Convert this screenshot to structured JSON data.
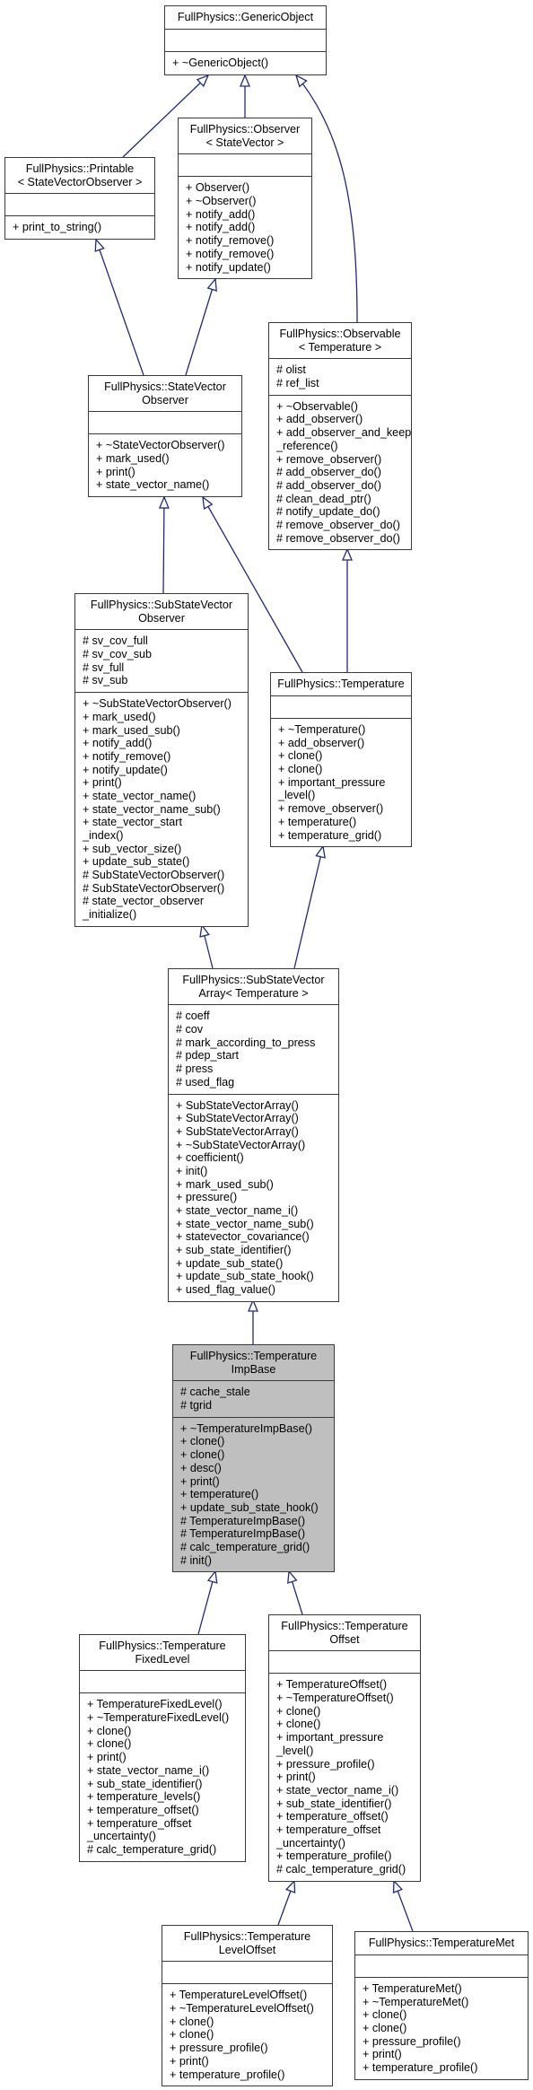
{
  "diagram": {
    "edge_color": "#1f2a7a",
    "highlight_fill": "#bfbfbf",
    "nodes": [
      {
        "id": "generic-object",
        "title": [
          "FullPhysics::GenericObject"
        ],
        "attributes": [],
        "methods": [
          "+ ~GenericObject()"
        ]
      },
      {
        "id": "printable",
        "title": [
          "FullPhysics::Printable",
          "< StateVectorObserver >"
        ],
        "attributes": [],
        "methods": [
          "+ print_to_string()"
        ]
      },
      {
        "id": "observer",
        "title": [
          "FullPhysics::Observer",
          "< StateVector >"
        ],
        "attributes": [],
        "methods": [
          "+ Observer()",
          "+ ~Observer()",
          "+ notify_add()",
          "+ notify_add()",
          "+ notify_remove()",
          "+ notify_remove()",
          "+ notify_update()"
        ]
      },
      {
        "id": "state-vector-observer",
        "title": [
          "FullPhysics::StateVector",
          "Observer"
        ],
        "attributes": [],
        "methods": [
          "+ ~StateVectorObserver()",
          "+ mark_used()",
          "+ print()",
          "+ state_vector_name()"
        ]
      },
      {
        "id": "observable",
        "title": [
          "FullPhysics::Observable",
          "< Temperature >"
        ],
        "attributes": [
          "# olist",
          "# ref_list"
        ],
        "methods": [
          "+ ~Observable()",
          "+ add_observer()",
          "+ add_observer_and_keep",
          "_reference()",
          "+ remove_observer()",
          "# add_observer_do()",
          "# add_observer_do()",
          "# clean_dead_ptr()",
          "# notify_update_do()",
          "# remove_observer_do()",
          "# remove_observer_do()"
        ]
      },
      {
        "id": "sub-state-vector-observer",
        "title": [
          "FullPhysics::SubStateVector",
          "Observer"
        ],
        "attributes": [
          "# sv_cov_full",
          "# sv_cov_sub",
          "# sv_full",
          "# sv_sub"
        ],
        "methods": [
          "+ ~SubStateVectorObserver()",
          "+ mark_used()",
          "+ mark_used_sub()",
          "+ notify_add()",
          "+ notify_remove()",
          "+ notify_update()",
          "+ print()",
          "+ state_vector_name()",
          "+ state_vector_name_sub()",
          "+ state_vector_start",
          "_index()",
          "+ sub_vector_size()",
          "+ update_sub_state()",
          "# SubStateVectorObserver()",
          "# SubStateVectorObserver()",
          "# state_vector_observer",
          "_initialize()"
        ]
      },
      {
        "id": "temperature",
        "title": [
          "FullPhysics::Temperature"
        ],
        "attributes": [],
        "methods": [
          "+ ~Temperature()",
          "+ add_observer()",
          "+ clone()",
          "+ clone()",
          "+ important_pressure",
          "_level()",
          "+ remove_observer()",
          "+ temperature()",
          "+ temperature_grid()"
        ]
      },
      {
        "id": "sub-state-vector-array",
        "title": [
          "FullPhysics::SubStateVector",
          "Array< Temperature >"
        ],
        "attributes": [
          "# coeff",
          "# cov",
          "# mark_according_to_press",
          "# pdep_start",
          "# press",
          "# used_flag"
        ],
        "methods": [
          "+ SubStateVectorArray()",
          "+ SubStateVectorArray()",
          "+ SubStateVectorArray()",
          "+ ~SubStateVectorArray()",
          "+ coefficient()",
          "+ init()",
          "+ mark_used_sub()",
          "+ pressure()",
          "+ state_vector_name_i()",
          "+ state_vector_name_sub()",
          "+ statevector_covariance()",
          "+ sub_state_identifier()",
          "+ update_sub_state()",
          "+ update_sub_state_hook()",
          "+ used_flag_value()"
        ]
      },
      {
        "id": "temperature-imp-base",
        "title": [
          "FullPhysics::Temperature",
          "ImpBase"
        ],
        "attributes": [
          "# cache_stale",
          "# tgrid"
        ],
        "methods": [
          "+ ~TemperatureImpBase()",
          "+ clone()",
          "+ clone()",
          "+ desc()",
          "+ print()",
          "+ temperature()",
          "+ update_sub_state_hook()",
          "# TemperatureImpBase()",
          "# TemperatureImpBase()",
          "# calc_temperature_grid()",
          "# init()"
        ],
        "highlighted": true
      },
      {
        "id": "temperature-fixed-level",
        "title": [
          "FullPhysics::Temperature",
          "FixedLevel"
        ],
        "attributes": [],
        "methods": [
          "+ TemperatureFixedLevel()",
          "+ ~TemperatureFixedLevel()",
          "+ clone()",
          "+ clone()",
          "+ print()",
          "+ state_vector_name_i()",
          "+ sub_state_identifier()",
          "+ temperature_levels()",
          "+ temperature_offset()",
          "+ temperature_offset",
          "_uncertainty()",
          "# calc_temperature_grid()"
        ]
      },
      {
        "id": "temperature-offset",
        "title": [
          "FullPhysics::Temperature",
          "Offset"
        ],
        "attributes": [],
        "methods": [
          "+ TemperatureOffset()",
          "+ ~TemperatureOffset()",
          "+ clone()",
          "+ clone()",
          "+ important_pressure",
          "_level()",
          "+ pressure_profile()",
          "+ print()",
          "+ state_vector_name_i()",
          "+ sub_state_identifier()",
          "+ temperature_offset()",
          "+ temperature_offset",
          "_uncertainty()",
          "+ temperature_profile()",
          "# calc_temperature_grid()"
        ]
      },
      {
        "id": "temperature-level-offset",
        "title": [
          "FullPhysics::Temperature",
          "LevelOffset"
        ],
        "attributes": [],
        "methods": [
          "+ TemperatureLevelOffset()",
          "+ ~TemperatureLevelOffset()",
          "+ clone()",
          "+ clone()",
          "+ pressure_profile()",
          "+ print()",
          "+ temperature_profile()"
        ]
      },
      {
        "id": "temperature-met",
        "title": [
          "FullPhysics::TemperatureMet"
        ],
        "attributes": [],
        "methods": [
          "+ TemperatureMet()",
          "+ ~TemperatureMet()",
          "+ clone()",
          "+ clone()",
          "+ pressure_profile()",
          "+ print()",
          "+ temperature_profile()"
        ]
      }
    ],
    "inheritance": [
      [
        "printable",
        "generic-object"
      ],
      [
        "observer",
        "generic-object"
      ],
      [
        "observable",
        "generic-object"
      ],
      [
        "state-vector-observer",
        "printable"
      ],
      [
        "state-vector-observer",
        "observer"
      ],
      [
        "sub-state-vector-observer",
        "state-vector-observer"
      ],
      [
        "temperature",
        "state-vector-observer"
      ],
      [
        "temperature",
        "observable"
      ],
      [
        "sub-state-vector-array",
        "sub-state-vector-observer"
      ],
      [
        "sub-state-vector-array",
        "temperature"
      ],
      [
        "temperature-imp-base",
        "sub-state-vector-array"
      ],
      [
        "temperature-fixed-level",
        "temperature-imp-base"
      ],
      [
        "temperature-offset",
        "temperature-imp-base"
      ],
      [
        "temperature-level-offset",
        "temperature-offset"
      ],
      [
        "temperature-met",
        "temperature-offset"
      ]
    ]
  }
}
